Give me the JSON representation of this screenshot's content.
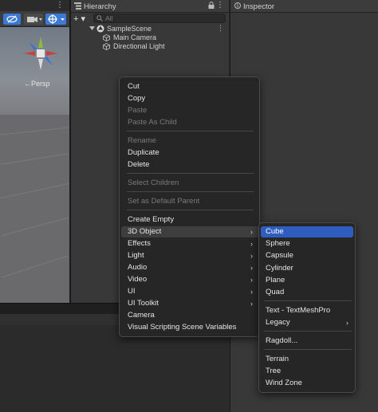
{
  "scene": {
    "persp_label": "←Persp",
    "more_glyph": "⋮"
  },
  "hierarchy": {
    "tab_title": "Hierarchy",
    "lock_glyph": "🔒",
    "more_glyph": "⋮",
    "add_label": "+ ▾",
    "search_placeholder": "All",
    "scene_name": "SampleScene",
    "items": [
      {
        "label": "Main Camera"
      },
      {
        "label": "Directional Light"
      }
    ]
  },
  "inspector": {
    "tab_title": "Inspector"
  },
  "context_menu": {
    "items": [
      {
        "label": "Cut",
        "disabled": false
      },
      {
        "label": "Copy",
        "disabled": false
      },
      {
        "label": "Paste",
        "disabled": true
      },
      {
        "label": "Paste As Child",
        "disabled": true
      },
      {
        "label": "Rename",
        "disabled": true
      },
      {
        "label": "Duplicate",
        "disabled": false
      },
      {
        "label": "Delete",
        "disabled": false
      },
      {
        "label": "Select Children",
        "disabled": true
      },
      {
        "label": "Set as Default Parent",
        "disabled": true
      },
      {
        "label": "Create Empty",
        "disabled": false
      },
      {
        "label": "3D Object",
        "disabled": false,
        "submenu": true
      },
      {
        "label": "Effects",
        "disabled": false,
        "submenu": true
      },
      {
        "label": "Light",
        "disabled": false,
        "submenu": true
      },
      {
        "label": "Audio",
        "disabled": false,
        "submenu": true
      },
      {
        "label": "Video",
        "disabled": false,
        "submenu": true
      },
      {
        "label": "UI",
        "disabled": false,
        "submenu": true
      },
      {
        "label": "UI Toolkit",
        "disabled": false,
        "submenu": true
      },
      {
        "label": "Camera",
        "disabled": false
      },
      {
        "label": "Visual Scripting Scene Variables",
        "disabled": false
      }
    ],
    "arrow_glyph": "›"
  },
  "submenu_3d_object": {
    "items": [
      {
        "label": "Cube",
        "selected": true
      },
      {
        "label": "Sphere"
      },
      {
        "label": "Capsule"
      },
      {
        "label": "Cylinder"
      },
      {
        "label": "Plane"
      },
      {
        "label": "Quad"
      },
      {
        "label": "Text - TextMeshPro"
      },
      {
        "label": "Legacy",
        "submenu": true
      },
      {
        "label": "Ragdoll..."
      },
      {
        "label": "Terrain"
      },
      {
        "label": "Tree"
      },
      {
        "label": "Wind Zone"
      }
    ]
  },
  "colors": {
    "selection_blue": "#2f5dbf",
    "toolbar_blue": "#3a79d7",
    "panel_bg": "#383838",
    "menu_bg": "#262626"
  }
}
